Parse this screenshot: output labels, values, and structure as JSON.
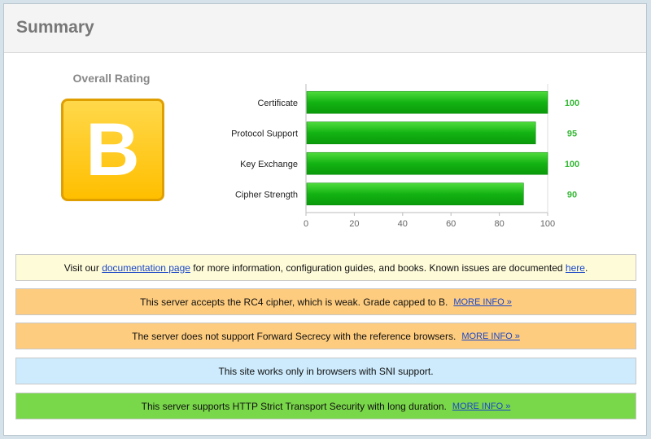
{
  "header": {
    "title": "Summary"
  },
  "rating": {
    "label": "Overall Rating",
    "grade": "B"
  },
  "chart_data": {
    "type": "bar",
    "orientation": "horizontal",
    "categories": [
      "Certificate",
      "Protocol Support",
      "Key Exchange",
      "Cipher Strength"
    ],
    "values": [
      100,
      95,
      100,
      90
    ],
    "value_labels": [
      "100",
      "95",
      "100",
      "90"
    ],
    "xlim": [
      0,
      100
    ],
    "xticks": [
      0,
      20,
      40,
      60,
      80,
      100
    ],
    "bar_color": "#13b313",
    "value_label_color": "#33b833",
    "grid": false
  },
  "notices": {
    "doc": {
      "prefix": "Visit our ",
      "link1": "documentation page",
      "middle": " for more information, configuration guides, and books. Known issues are documented ",
      "link2": "here",
      "suffix": "."
    },
    "rc4": {
      "text": "This server accepts the RC4 cipher, which is weak. Grade capped to B.",
      "more": "MORE INFO »"
    },
    "fs": {
      "text": "The server does not support Forward Secrecy with the reference browsers.",
      "more": "MORE INFO »"
    },
    "sni": {
      "text": "This site works only in browsers with SNI support."
    },
    "hsts": {
      "text": "This server supports HTTP Strict Transport Security with long duration.",
      "more": "MORE INFO »"
    }
  },
  "colors": {
    "warning": "#fecc7e",
    "info": "#cdebfc",
    "success": "#79d74a",
    "note": "#fefbd9",
    "grade": "#ffc72c"
  }
}
